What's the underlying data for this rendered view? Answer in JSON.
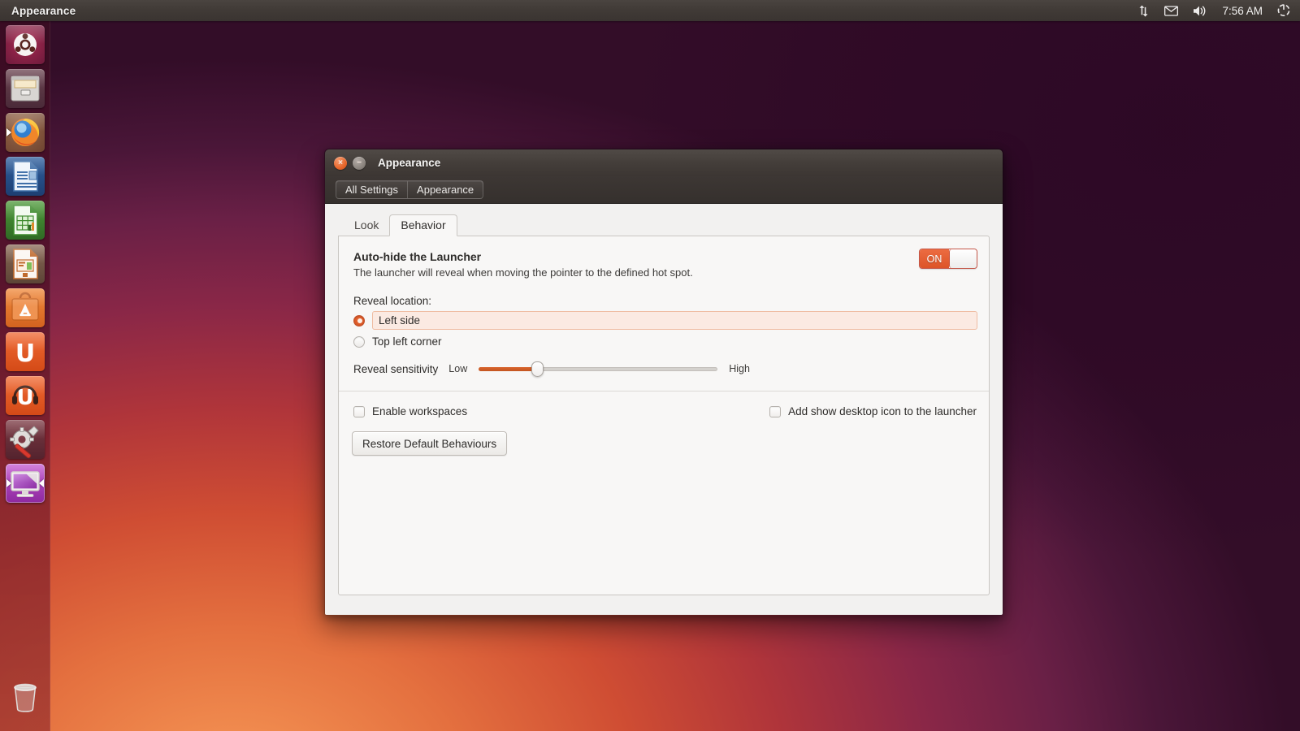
{
  "panel": {
    "app_title": "Appearance",
    "clock": "7:56 AM",
    "indicators": [
      {
        "name": "network-icon",
        "glyph": "⇅"
      },
      {
        "name": "messaging-icon",
        "glyph": "✉"
      },
      {
        "name": "volume-icon",
        "glyph": "🔊"
      },
      {
        "name": "session-icon",
        "glyph": "⏻"
      }
    ]
  },
  "launcher": {
    "items": [
      {
        "name": "ubuntu-dash-icon",
        "label": "Dash home"
      },
      {
        "name": "files-icon",
        "label": "Files"
      },
      {
        "name": "firefox-icon",
        "label": "Firefox Web Browser"
      },
      {
        "name": "libreoffice-writer-icon",
        "label": "LibreOffice Writer"
      },
      {
        "name": "libreoffice-calc-icon",
        "label": "LibreOffice Calc"
      },
      {
        "name": "libreoffice-impress-icon",
        "label": "LibreOffice Impress"
      },
      {
        "name": "software-center-icon",
        "label": "Ubuntu Software Center"
      },
      {
        "name": "ubuntu-one-icon",
        "label": "Ubuntu One"
      },
      {
        "name": "ubuntu-one-music-icon",
        "label": "Ubuntu One Music"
      },
      {
        "name": "system-settings-icon",
        "label": "System Settings"
      },
      {
        "name": "appearance-icon",
        "label": "Appearance",
        "active": true
      }
    ],
    "trash": {
      "name": "trash-icon",
      "label": "Rubbish Bin"
    }
  },
  "window": {
    "title": "Appearance",
    "close_label": "×",
    "minimize_label": "−",
    "toolbar": {
      "all_settings": "All Settings",
      "appearance": "Appearance"
    },
    "tabs": [
      {
        "label": "Look",
        "selected": false
      },
      {
        "label": "Behavior",
        "selected": true
      }
    ],
    "behavior": {
      "autohide_title": "Auto-hide the Launcher",
      "autohide_desc": "The launcher will reveal when moving the pointer to the defined hot spot.",
      "toggle": {
        "state_label": "ON",
        "value": "on"
      },
      "reveal_location_label": "Reveal location:",
      "reveal_options": [
        {
          "label": "Left side",
          "selected": true
        },
        {
          "label": "Top left corner",
          "selected": false
        }
      ],
      "sensitivity": {
        "label": "Reveal sensitivity",
        "min_label": "Low",
        "max_label": "High",
        "value_percent": 24
      },
      "checkboxes": [
        {
          "label": "Enable workspaces",
          "checked": false
        },
        {
          "label": "Add show desktop icon to the launcher",
          "checked": false
        }
      ],
      "restore_button": "Restore Default Behaviours"
    }
  },
  "colors": {
    "accent_orange": "#dd5528",
    "panel_bg": "#3a3431",
    "window_bg": "#f2f1f0",
    "highlight_bg": "#fbeae2"
  }
}
